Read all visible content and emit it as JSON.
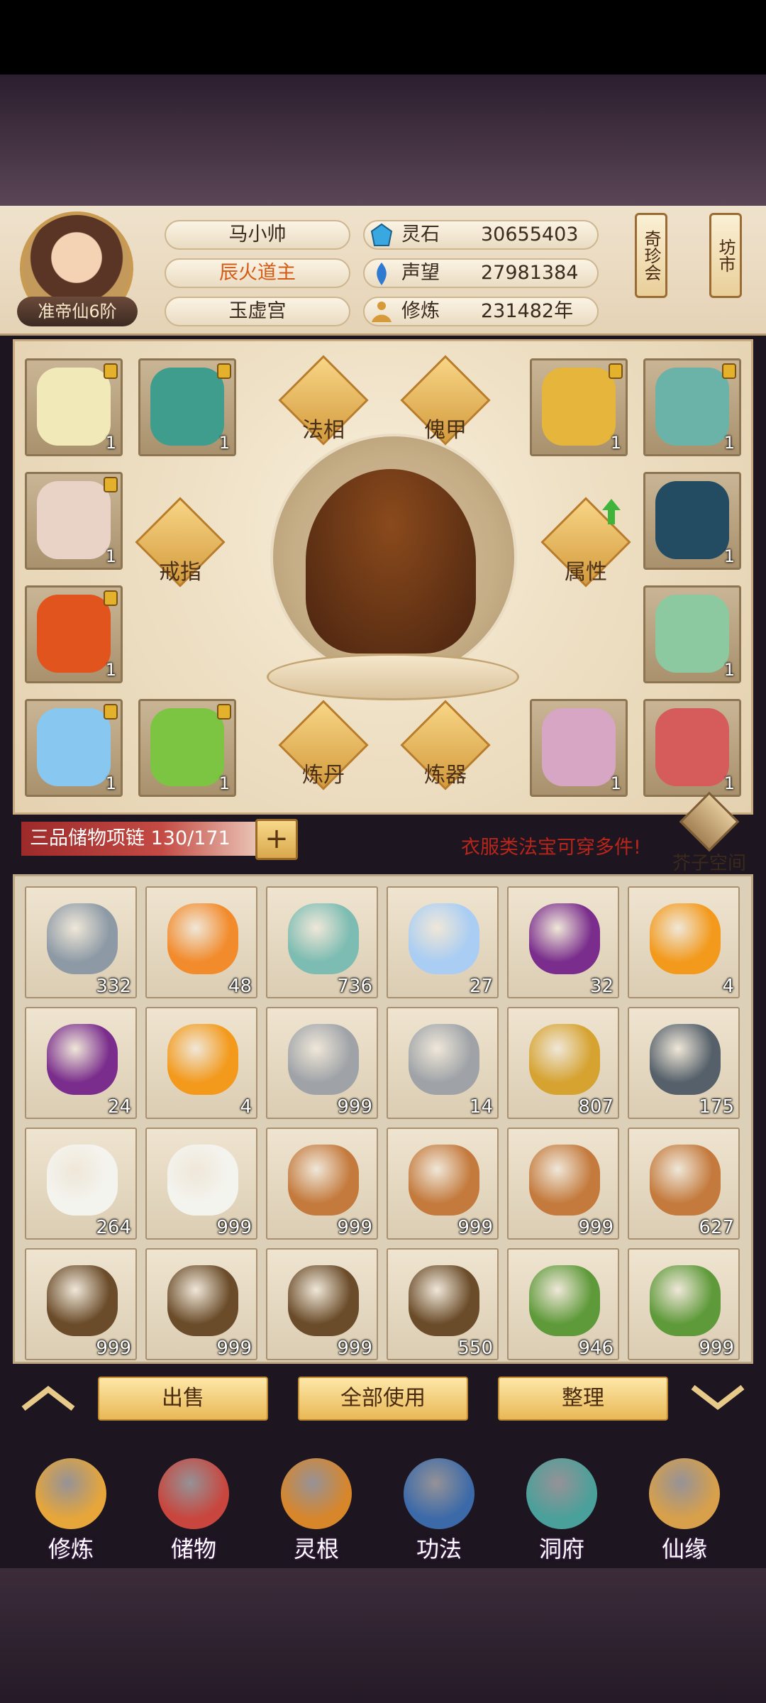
{
  "player": {
    "name": "马小帅",
    "title": "辰火道主",
    "sect": "玉虚宫",
    "rank": "准帝仙6阶"
  },
  "resources": [
    {
      "label": "灵石",
      "value": "30655403",
      "icon": "spirit-stone-icon",
      "color": "#3aa8e0"
    },
    {
      "label": "声望",
      "value": "27981384",
      "icon": "reputation-icon",
      "color": "#2f7ad1"
    },
    {
      "label": "修炼",
      "value": "231482年",
      "icon": "cultivation-icon",
      "color": "#d79a3a"
    }
  ],
  "side_buttons": [
    {
      "label": "奇珍会",
      "icon": "treasure-fair-icon"
    },
    {
      "label": "坊市",
      "icon": "market-icon"
    }
  ],
  "equipment": {
    "left_slots": [
      {
        "count": "1",
        "locked": true,
        "icon": "white-robe-icon",
        "color": "#f1e9b8"
      },
      {
        "count": "1",
        "locked": true,
        "icon": "teal-armor-icon",
        "color": "#3e9d8c"
      },
      {
        "count": "1",
        "locked": true,
        "icon": "white-red-robe-icon",
        "color": "#e9d2c6"
      },
      {
        "count": "1",
        "locked": true,
        "icon": "flame-armor-icon",
        "color": "#e2541e"
      },
      {
        "count": "1",
        "locked": true,
        "icon": "ice-armor-icon",
        "color": "#88c8f0"
      },
      {
        "count": "1",
        "locked": true,
        "icon": "green-armor-icon",
        "color": "#7bc543"
      }
    ],
    "right_slots": [
      {
        "count": "1",
        "locked": true,
        "icon": "golden-shield-icon",
        "color": "#e6b53b"
      },
      {
        "count": "1",
        "locked": true,
        "icon": "blade-icon",
        "color": "#6bb3a8"
      },
      {
        "count": "1",
        "locked": false,
        "icon": "dark-cloak-icon",
        "color": "#234b62"
      },
      {
        "count": "1",
        "locked": false,
        "icon": "jade-robe-icon",
        "color": "#8dc9a0"
      },
      {
        "count": "1",
        "locked": false,
        "icon": "pink-wings-icon",
        "color": "#d7a6c5"
      },
      {
        "count": "1",
        "locked": false,
        "icon": "red-wings-icon",
        "color": "#d65b5b"
      }
    ],
    "functions": {
      "faxiang": "法相",
      "kuijia": "傀甲",
      "jiezhi": "戒指",
      "shuxing": "属性",
      "liandan": "炼丹",
      "lianqi": "炼器"
    }
  },
  "storage": {
    "label": "三品储物项链 130/171",
    "notice": "衣服类法宝可穿多件!",
    "pocket_label": "芥子空间"
  },
  "inventory": [
    {
      "count": "332",
      "icon": "iron-shards-icon",
      "color": "#8d9aa6"
    },
    {
      "count": "48",
      "icon": "amber-ore-icon",
      "color": "#f28b2c"
    },
    {
      "count": "736",
      "icon": "green-orb-icon",
      "color": "#7cbcb2"
    },
    {
      "count": "27",
      "icon": "blue-orb-icon",
      "color": "#a9cdf3"
    },
    {
      "count": "32",
      "icon": "purple-flame-icon",
      "color": "#7a2d8c"
    },
    {
      "count": "4",
      "icon": "orange-flame-icon",
      "color": "#f39a1c"
    },
    {
      "count": "24",
      "icon": "purple-flame-icon",
      "color": "#7a2d8c"
    },
    {
      "count": "4",
      "icon": "orange-flame-icon",
      "color": "#f39a1c"
    },
    {
      "count": "999",
      "icon": "grey-crystal-icon",
      "color": "#9fa3a8"
    },
    {
      "count": "14",
      "icon": "grey-crystal-icon",
      "color": "#9fa3a8"
    },
    {
      "count": "807",
      "icon": "gold-ore-icon",
      "color": "#d6a331"
    },
    {
      "count": "175",
      "icon": "dark-ore-icon",
      "color": "#55606a"
    },
    {
      "count": "264",
      "icon": "white-lily-icon",
      "color": "#f4f4ef"
    },
    {
      "count": "999",
      "icon": "white-lily-icon",
      "color": "#f4f4ef"
    },
    {
      "count": "999",
      "icon": "ginseng-icon",
      "color": "#c47a3d"
    },
    {
      "count": "999",
      "icon": "ginseng-icon",
      "color": "#c47a3d"
    },
    {
      "count": "999",
      "icon": "ginseng-icon",
      "color": "#c47a3d"
    },
    {
      "count": "627",
      "icon": "ginseng-icon",
      "color": "#c47a3d"
    },
    {
      "count": "999",
      "icon": "root-herb-icon",
      "color": "#6b4c2a"
    },
    {
      "count": "999",
      "icon": "root-herb-icon",
      "color": "#6b4c2a"
    },
    {
      "count": "999",
      "icon": "root-herb-icon",
      "color": "#6b4c2a"
    },
    {
      "count": "550",
      "icon": "root-herb-icon",
      "color": "#6b4c2a"
    },
    {
      "count": "946",
      "icon": "red-flower-herb-icon",
      "color": "#5f9a3a"
    },
    {
      "count": "999",
      "icon": "red-flower-herb-icon",
      "color": "#5f9a3a"
    }
  ],
  "actions": {
    "sell": "出售",
    "use_all": "全部使用",
    "sort": "整理"
  },
  "nav": [
    {
      "label": "修炼",
      "icon": "meditate-icon",
      "color": "#e6a63a"
    },
    {
      "label": "储物",
      "icon": "storage-bag-icon",
      "color": "#c8463d"
    },
    {
      "label": "灵根",
      "icon": "spirit-root-icon",
      "color": "#d8862a"
    },
    {
      "label": "功法",
      "icon": "technique-book-icon",
      "color": "#3c6aa8"
    },
    {
      "label": "洞府",
      "icon": "cave-dwelling-icon",
      "color": "#4aa09a"
    },
    {
      "label": "仙缘",
      "icon": "fortune-gourd-icon",
      "color": "#d8a04a"
    }
  ]
}
